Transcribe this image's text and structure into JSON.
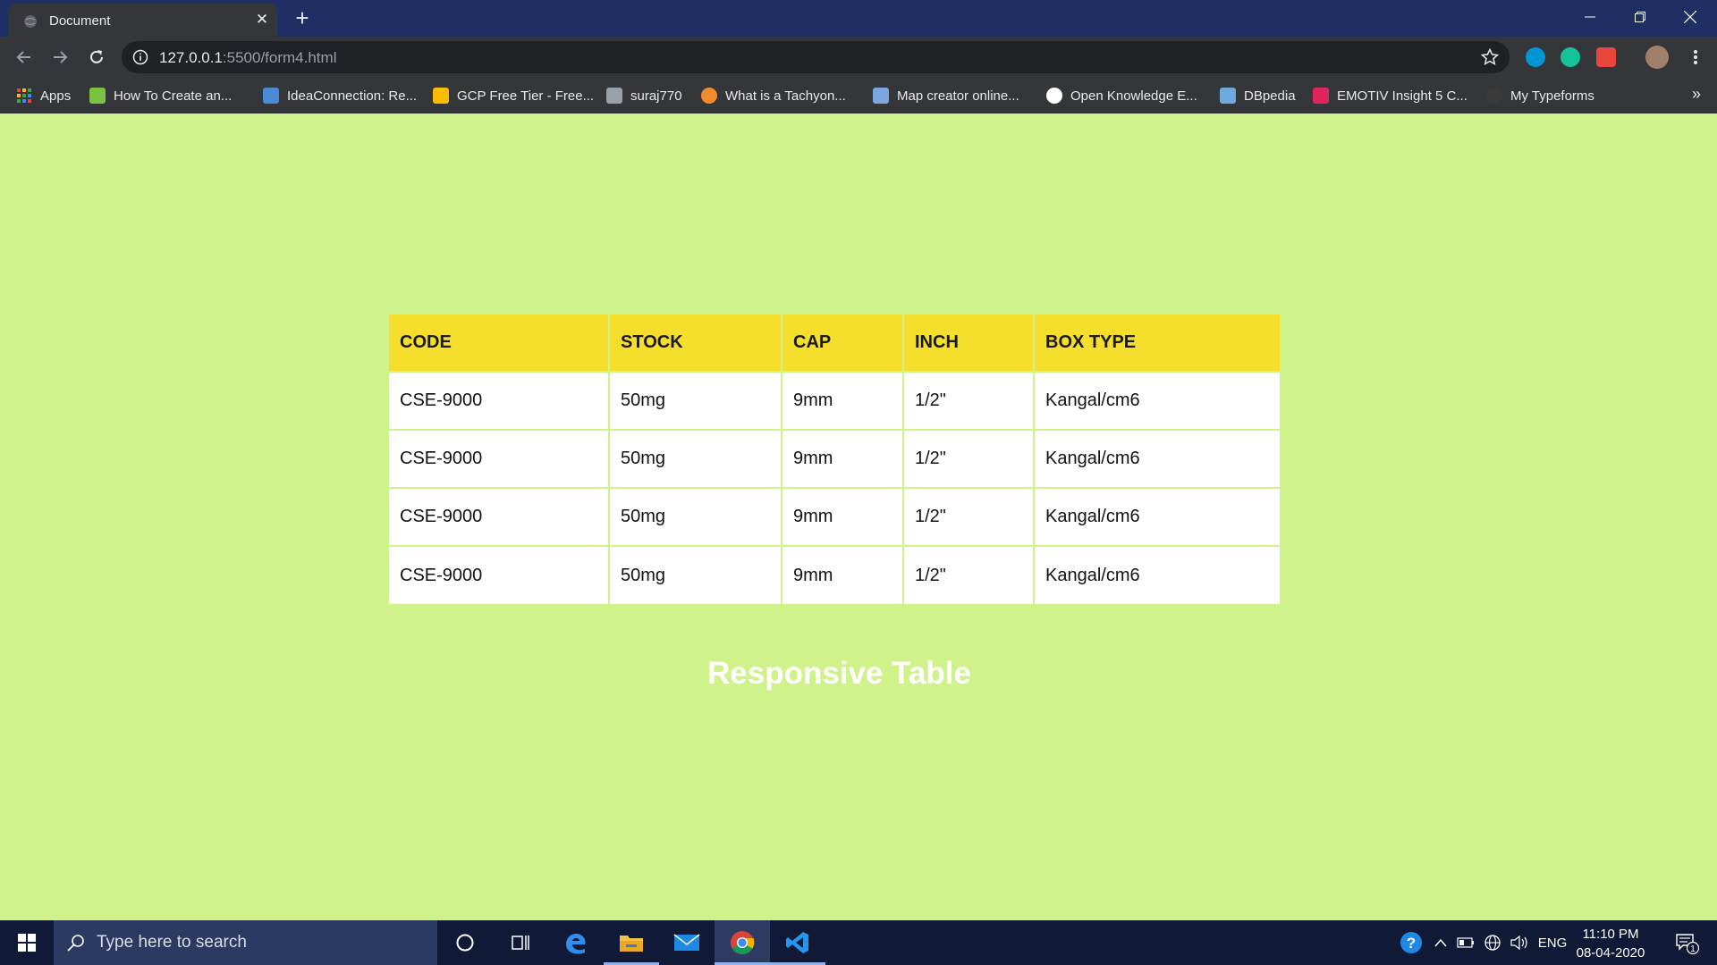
{
  "browser": {
    "tab_title": "Document",
    "url_host": "127.0.0.1",
    "url_rest": ":5500/form4.html",
    "bookmarks": [
      {
        "label": "Apps",
        "icon": "apps-grid-icon",
        "color": "#e94235"
      },
      {
        "label": "How To Create an...",
        "icon": "site-icon",
        "color": "#7cc242"
      },
      {
        "label": "IdeaConnection: Re...",
        "icon": "ideaconnection-icon",
        "color": "#4b8bd6"
      },
      {
        "label": "GCP Free Tier - Free...",
        "icon": "google-cloud-icon",
        "color": "#fbbc04"
      },
      {
        "label": "suraj770",
        "icon": "dots-icon",
        "color": "#9aa0a6"
      },
      {
        "label": "What is a Tachyon...",
        "icon": "tachyon-icon",
        "color": "#f28b2c"
      },
      {
        "label": "Map creator online...",
        "icon": "zm-icon",
        "color": "#7aa7e0"
      },
      {
        "label": "Open Knowledge E...",
        "icon": "globe-icon",
        "color": "#ffffff"
      },
      {
        "label": "DBpedia",
        "icon": "dbpedia-icon",
        "color": "#6fa8dc"
      },
      {
        "label": "EMOTIV Insight 5 C...",
        "icon": "emotiv-icon",
        "color": "#e0245e"
      },
      {
        "label": "My Typeforms",
        "icon": "typeform-icon",
        "color": "#3a3a3a"
      }
    ],
    "more_bookmarks": "»"
  },
  "table": {
    "headers": [
      "CODE",
      "STOCK",
      "CAP",
      "INCH",
      "BOX TYPE"
    ],
    "rows": [
      [
        "CSE-9000",
        "50mg",
        "9mm",
        "1/2\"",
        "Kangal/cm6"
      ],
      [
        "CSE-9000",
        "50mg",
        "9mm",
        "1/2\"",
        "Kangal/cm6"
      ],
      [
        "CSE-9000",
        "50mg",
        "9mm",
        "1/2\"",
        "Kangal/cm6"
      ],
      [
        "CSE-9000",
        "50mg",
        "9mm",
        "1/2\"",
        "Kangal/cm6"
      ]
    ]
  },
  "caption": "Responsive Table",
  "taskbar": {
    "search_placeholder": "Type here to search",
    "language": "ENG",
    "time": "11:10 PM",
    "date": "08-04-2020",
    "notification_count": "1"
  },
  "colors": {
    "page_background": "#d0f28a",
    "header_background": "#f5df2c",
    "row_background": "#ffffff",
    "caption_text": "#ffffff"
  }
}
